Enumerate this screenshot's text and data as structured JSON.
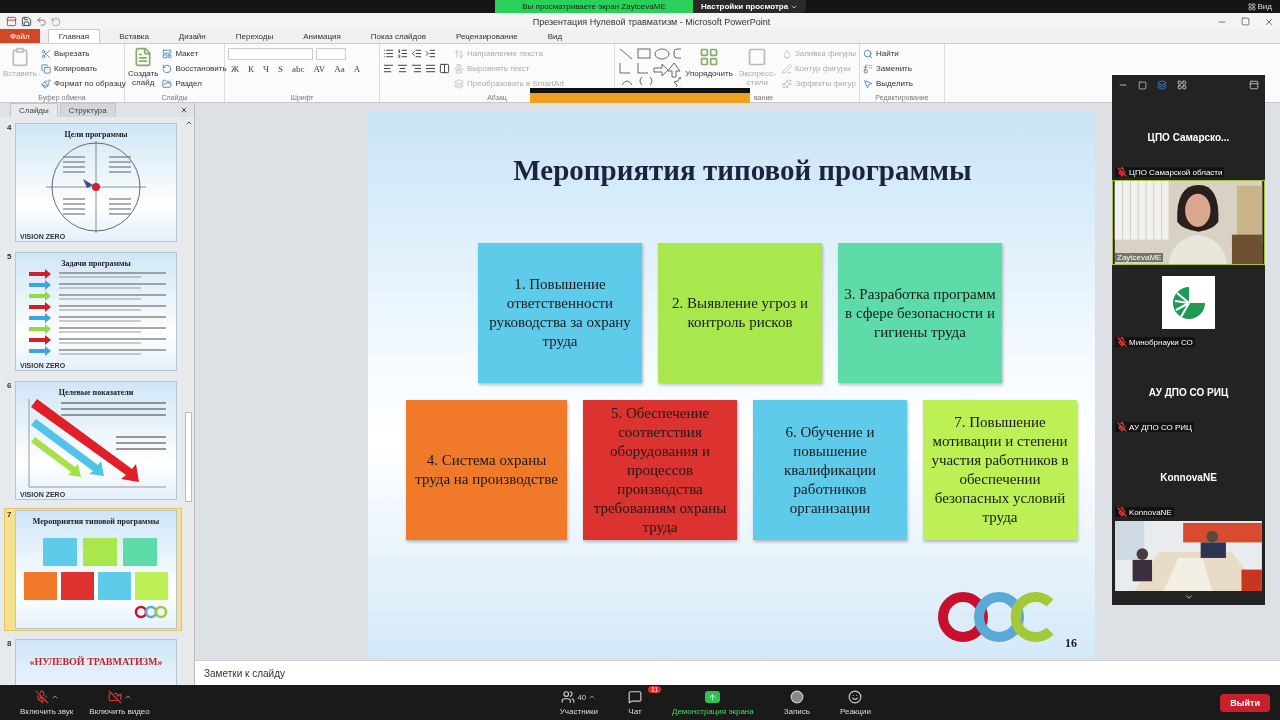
{
  "share_banner": {
    "text": "Вы просматриваете экран ZaytcevaME",
    "settings": "Настройки просмотра",
    "view": "Вид"
  },
  "window": {
    "title": "Презентация Нулевой травматизм - Microsoft PowerPoint"
  },
  "tabs": [
    {
      "label": "Файл",
      "kind": "file",
      "selected": false
    },
    {
      "label": "Главная",
      "kind": "tab",
      "selected": true
    },
    {
      "label": "Вставка",
      "kind": "tab",
      "selected": false
    },
    {
      "label": "Дизайн",
      "kind": "tab",
      "selected": false
    },
    {
      "label": "Переходы",
      "kind": "tab",
      "selected": false
    },
    {
      "label": "Анимация",
      "kind": "tab",
      "selected": false
    },
    {
      "label": "Показ слайдов",
      "kind": "tab",
      "selected": false
    },
    {
      "label": "Рецензирование",
      "kind": "tab",
      "selected": false
    },
    {
      "label": "Вид",
      "kind": "tab",
      "selected": false
    }
  ],
  "ribbon": {
    "groups": [
      {
        "kind": "clipboard",
        "label": "Буфер обмена",
        "big": [
          {
            "label": "Вставить",
            "disabled": true
          }
        ],
        "items": [
          {
            "label": "Вырезать",
            "disabled": false
          },
          {
            "label": "Копировать",
            "disabled": false
          },
          {
            "label": "Формат по образцу",
            "disabled": false
          }
        ]
      },
      {
        "kind": "slides",
        "label": "Слайды",
        "big": [
          {
            "label": "Создать слайд",
            "disabled": false
          }
        ],
        "items": [
          {
            "label": "Макет",
            "disabled": false
          },
          {
            "label": "Восстановить",
            "disabled": false
          },
          {
            "label": "Раздел",
            "disabled": false
          }
        ]
      },
      {
        "kind": "font",
        "label": "Шрифт",
        "glyphs": [
          "Ж",
          "К",
          "Ч",
          "S",
          "abc",
          "AV",
          "Aa",
          "A"
        ]
      },
      {
        "kind": "paragraph",
        "label": "Абзац",
        "items": [
          {
            "label": "Направление текста",
            "disabled": true
          },
          {
            "label": "Выровнять текст",
            "disabled": true
          },
          {
            "label": "Преобразовать в SmartArt",
            "disabled": true
          }
        ]
      },
      {
        "kind": "drawing",
        "label": "вание",
        "big": [
          {
            "label": "Упорядочить",
            "disabled": false
          },
          {
            "label": "Экспресс-стили",
            "disabled": true
          }
        ],
        "items": [
          {
            "label": "Заливка фигуры",
            "disabled": true
          },
          {
            "label": "Контур фигуры",
            "disabled": true
          },
          {
            "label": "Эффекты фигур",
            "disabled": true
          }
        ]
      },
      {
        "kind": "editing",
        "label": "Редактирование",
        "items": [
          {
            "label": "Найти",
            "disabled": false
          },
          {
            "label": "Заменить",
            "disabled": false
          },
          {
            "label": "Выделить",
            "disabled": false
          }
        ]
      }
    ]
  },
  "slides_panel": {
    "tabs": [
      {
        "label": "Слайды",
        "selected": true
      },
      {
        "label": "Структура",
        "selected": false
      }
    ],
    "thumbnails": [
      {
        "number": "4",
        "title": "Цели программы",
        "kind": "circle",
        "footer": "VISION ZERO",
        "selected": false
      },
      {
        "number": "5",
        "title": "Задачи программы",
        "kind": "arrows",
        "footer": "VISION ZERO",
        "selected": false
      },
      {
        "number": "6",
        "title": "Целевые показатели",
        "kind": "diagonal",
        "footer": "VISION ZERO",
        "selected": false
      },
      {
        "number": "7",
        "title": "Мероприятия типовой программы",
        "kind": "boxes",
        "selected": true
      },
      {
        "number": "8",
        "title": "«НУЛЕВОЙ ТРАВМАТИЗМ»",
        "kind": "cover",
        "selected": false
      }
    ]
  },
  "slide": {
    "title": "Мероприятия типовой программы",
    "page": "16",
    "boxes": [
      {
        "text": "1. Повышение ответственности руководства за охрану труда",
        "color": "#5ecbea"
      },
      {
        "text": "2. Выявление  угроз и контроль рисков",
        "color": "#a8e84c"
      },
      {
        "text": "3. Разработка программ в сфере безопасности и гигиены труда",
        "color": "#5ddba9"
      },
      {
        "text": "4. Система охраны труда на производстве",
        "color": "#f07a2a"
      },
      {
        "text": "5. Обеспечение соответствия оборудования и процессов производства требованиям охраны труда",
        "color": "#dc3330"
      },
      {
        "text": "6. Обучение и повышение квалификации работников организации",
        "color": "#5ecbea"
      },
      {
        "text": "7. Повышение мотивации и степени участия работников в обеспечении безопасных условий труда",
        "color": "#bcf055"
      }
    ]
  },
  "notes": {
    "placeholder": "Заметки к слайду"
  },
  "participants": [
    {
      "kind": "name",
      "name": "ЦПО  Самарско...",
      "label": "ЦПО Самарской области",
      "muted": true,
      "active": false
    },
    {
      "kind": "video",
      "label": "ZaytcevaME",
      "muted": false,
      "active": true
    },
    {
      "kind": "logo",
      "label": "Минобрнауки СО",
      "muted": true,
      "active": false
    },
    {
      "kind": "name",
      "name": "АУ ДПО СО РИЦ",
      "label": "АУ ДПО СО РИЦ",
      "muted": true,
      "active": false
    },
    {
      "kind": "name",
      "name": "KonnovaNE",
      "label": "KonnovaNE",
      "muted": true,
      "active": false
    },
    {
      "kind": "room"
    }
  ],
  "toolbar": {
    "items": [
      {
        "kind": "audio",
        "label": "Включить звук"
      },
      {
        "kind": "video",
        "label": "Включить видео"
      },
      {
        "kind": "participants",
        "label": "Участники",
        "count": "40"
      },
      {
        "kind": "chat",
        "label": "Чат",
        "badge": "11"
      },
      {
        "kind": "share",
        "label": "Демонстрация экрана"
      },
      {
        "kind": "record",
        "label": "Запись"
      },
      {
        "kind": "reactions",
        "label": "Реакции"
      }
    ],
    "leave": "Выйти"
  }
}
